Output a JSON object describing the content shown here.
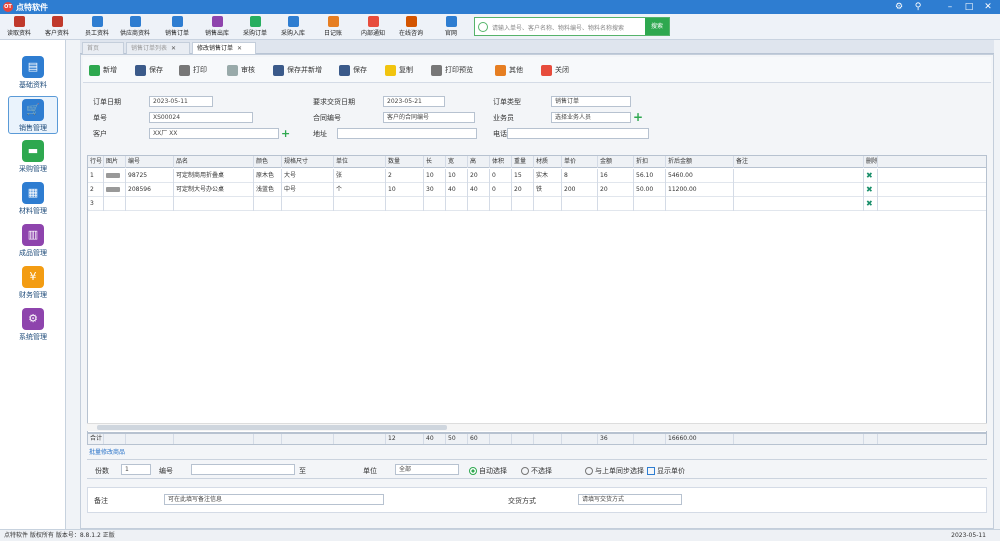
{
  "app": {
    "logo": "OT",
    "title": "点特软件"
  },
  "toolbar": [
    {
      "label": "读取资料",
      "color": "#c0392b"
    },
    {
      "label": "客户资料",
      "color": "#c0392b"
    },
    {
      "label": "员工资料",
      "color": "#2e7dd1"
    },
    {
      "label": "供应商资料",
      "color": "#2e7dd1"
    },
    {
      "label": "销售订单",
      "color": "#2e7dd1"
    },
    {
      "label": "销售出库",
      "color": "#8e44ad"
    },
    {
      "label": "采购订单",
      "color": "#27ae60"
    },
    {
      "label": "采购入库",
      "color": "#2e7dd1"
    },
    {
      "label": "日记账",
      "color": "#e67e22"
    },
    {
      "label": "内部通知",
      "color": "#e74c3c"
    },
    {
      "label": "在线咨询",
      "color": "#d35400"
    },
    {
      "label": "官网",
      "color": "#2e7dd1"
    }
  ],
  "search": {
    "placeholder": "请输入单号、客户名称、物料编号、物料名称搜索",
    "button": "搜索"
  },
  "sidebar": [
    {
      "label": "基础资料",
      "icon": "folder-icon",
      "color": "#2e7dd1",
      "glyph": "▤",
      "active": false
    },
    {
      "label": "销售管理",
      "icon": "cart-icon",
      "color": "#2e7dd1",
      "glyph": "🛒",
      "active": true
    },
    {
      "label": "采购管理",
      "icon": "truck-icon",
      "color": "#2ea84f",
      "glyph": "▬",
      "active": false
    },
    {
      "label": "材料管理",
      "icon": "warehouse-icon",
      "color": "#2e7dd1",
      "glyph": "▦",
      "active": false
    },
    {
      "label": "成品管理",
      "icon": "factory-icon",
      "color": "#8e44ad",
      "glyph": "▥",
      "active": false
    },
    {
      "label": "财务管理",
      "icon": "money-icon",
      "color": "#f39c12",
      "glyph": "¥",
      "active": false
    },
    {
      "label": "系统管理",
      "icon": "gear-icon",
      "color": "#8e44ad",
      "glyph": "⚙",
      "active": false
    }
  ],
  "tabs": [
    {
      "label": "首页",
      "active": false
    },
    {
      "label": "销售订单列表",
      "active": false
    },
    {
      "label": "修改销售订单",
      "active": true
    }
  ],
  "actions": [
    {
      "label": "新增",
      "icon": "plus-icon",
      "color": "#2ea84f"
    },
    {
      "label": "保存",
      "icon": "save-icon",
      "color": "#3b5a8a"
    },
    {
      "label": "打印",
      "icon": "print-icon",
      "color": "#777"
    },
    {
      "label": "审核",
      "icon": "audit-icon",
      "color": "#9aa"
    },
    {
      "label": "保存并新增",
      "icon": "save-new-icon",
      "color": "#3b5a8a"
    },
    {
      "label": "保存",
      "icon": "save-icon",
      "color": "#3b5a8a"
    },
    {
      "label": "复制",
      "icon": "copy-icon",
      "color": "#f1c40f"
    },
    {
      "label": "打印预览",
      "icon": "preview-icon",
      "color": "#777"
    },
    {
      "label": "其他",
      "icon": "more-icon",
      "color": "#e67e22"
    },
    {
      "label": "关闭",
      "icon": "close-icon",
      "color": "#e74c3c"
    }
  ],
  "form": {
    "order_date_label": "订单日期",
    "order_date": "2023-05-11",
    "order_no_label": "单号",
    "order_no": "XS00024",
    "customer_label": "客户",
    "customer": "XX厂 XX",
    "delivery_date_label": "要求交货日期",
    "delivery_date": "2023-05-21",
    "contract_label": "合同编号",
    "contract": "客户的合同编号",
    "address_label": "地址",
    "address": "",
    "order_type_label": "订单类型",
    "order_type": "销售订单",
    "salesman_label": "业务员",
    "salesman": "选择业务人员",
    "phone_label": "电话",
    "phone": ""
  },
  "grid": {
    "headers": [
      "行号",
      "图片",
      "编号",
      "品名",
      "颜色",
      "规格尺寸",
      "单位",
      "数量",
      "长",
      "宽",
      "高",
      "体积",
      "重量",
      "材质",
      "单价",
      "金额",
      "折扣",
      "折后金额",
      "备注",
      "删除"
    ],
    "rows": [
      {
        "no": "1",
        "code": "98725",
        "name": "可定制商用折叠桌",
        "color": "原木色",
        "spec": "大号",
        "unit": "张",
        "qty": "2",
        "l": "10",
        "w": "10",
        "h": "20",
        "vol": "0",
        "wt": "15",
        "mat": "实木",
        "price": "8",
        "amount": "16",
        "discount": "56.10",
        "net": "5460.00"
      },
      {
        "no": "2",
        "code": "208596",
        "name": "可定制大号办公桌",
        "color": "浅蓝色",
        "spec": "中号",
        "unit": "个",
        "qty": "10",
        "l": "30",
        "w": "40",
        "h": "40",
        "vol": "0",
        "wt": "20",
        "mat": "铁",
        "price": "200",
        "amount": "20",
        "discount": "50.00",
        "net": "11200.00"
      },
      {
        "no": "3",
        "code": "",
        "name": "",
        "color": "",
        "spec": "",
        "unit": "",
        "qty": "",
        "l": "",
        "w": "",
        "h": "",
        "vol": "",
        "wt": "",
        "mat": "",
        "price": "",
        "amount": "",
        "discount": "",
        "net": ""
      }
    ],
    "total_label": "合计",
    "totals": {
      "qty": "12",
      "l": "40",
      "w": "50",
      "h": "60",
      "amount": "36",
      "net": "16660.00"
    }
  },
  "links": {
    "batch": "批量修改商品"
  },
  "options": {
    "copies_label": "份数",
    "copies": "1",
    "from_label": "编号",
    "from": "",
    "to_label": "至",
    "unit_label": "单位",
    "unit_value": "全部",
    "radio1": "自动选择",
    "radio2": "不选择",
    "radio3": "与上单同步选择",
    "check": "显示单价"
  },
  "remark": {
    "label": "备注",
    "value": "可在此填写备注信息",
    "delivery_label": "交货方式",
    "delivery_placeholder": "请填写交货方式"
  },
  "status": {
    "left": "点特软件 版权所有 版本号：8.8.1.2 正版",
    "right": "2023-05-11"
  }
}
